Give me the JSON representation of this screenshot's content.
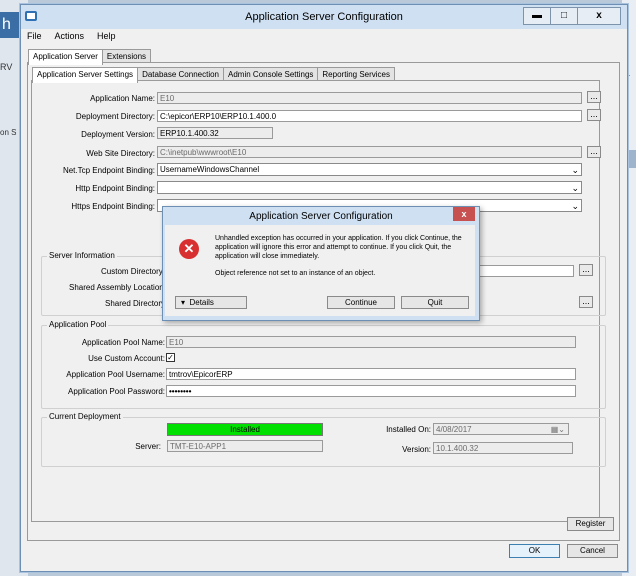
{
  "background": {
    "left_fragment": "h",
    "left_text1": "RV",
    "left_text2": "on S",
    "right_fragment": "a"
  },
  "window": {
    "title": "Application Server Configuration",
    "controls": {
      "min": "▬",
      "max": "□",
      "close": "x"
    }
  },
  "menu": [
    "File",
    "Actions",
    "Help"
  ],
  "top_tabs": [
    "Application Server",
    "Extensions"
  ],
  "sub_tabs": [
    "Application Server Settings",
    "Database Connection",
    "Admin Console Settings",
    "Reporting Services"
  ],
  "settings": {
    "application_name": {
      "label": "Application Name:",
      "value": "E10"
    },
    "deployment_directory": {
      "label": "Deployment Directory:",
      "value": "C:\\epicor\\ERP10\\ERP10.1.400.0"
    },
    "deployment_version": {
      "label": "Deployment Version:",
      "value": "ERP10.1.400.32"
    },
    "web_site_directory": {
      "label": "Web Site Directory:",
      "value": "C:\\inetpub\\wwwroot\\E10"
    },
    "net_tcp_binding": {
      "label": "Net.Tcp Endpoint Binding:",
      "value": "UsernameWindowsChannel"
    },
    "http_binding": {
      "label": "Http Endpoint Binding:",
      "value": ""
    },
    "https_binding": {
      "label": "Https Endpoint Binding:",
      "value": ""
    }
  },
  "server_info": {
    "title": "Server Information",
    "custom_directory": "Custom Directory",
    "shared_assembly": "Shared Assembly Location",
    "shared_directory": "Shared Directory"
  },
  "app_pool": {
    "title": "Application Pool",
    "name": {
      "label": "Application Pool Name:",
      "value": "E10"
    },
    "use_custom": {
      "label": "Use Custom Account:",
      "checked": "✓"
    },
    "username": {
      "label": "Application Pool Username:",
      "value": "tmtrov\\EpicorERP"
    },
    "password": {
      "label": "Application Pool Password:",
      "value": "••••••••"
    }
  },
  "deployment": {
    "title": "Current Deployment",
    "status": "Installed",
    "server": {
      "label": "Server:",
      "value": "TMT-E10-APP1"
    },
    "installed_on": {
      "label": "Installed On:",
      "value": "4/08/2017"
    },
    "version": {
      "label": "Version:",
      "value": "10.1.400.32"
    }
  },
  "buttons": {
    "register": "Register",
    "ok": "OK",
    "cancel": "Cancel",
    "browse": "..."
  },
  "dialog": {
    "title": "Application Server Configuration",
    "close": "x",
    "message": "Unhandled exception has occurred in your application. If you click Continue, the application will ignore this error and attempt to continue. If you click Quit, the application will close immediately.",
    "detail": "Object reference not set to an instance of an object.",
    "details_button": "Details",
    "continue_button": "Continue",
    "quit_button": "Quit"
  },
  "colors": {
    "installed_green": "#00e000",
    "error_red": "#d83030",
    "titlebar": "#cfe0f2"
  }
}
